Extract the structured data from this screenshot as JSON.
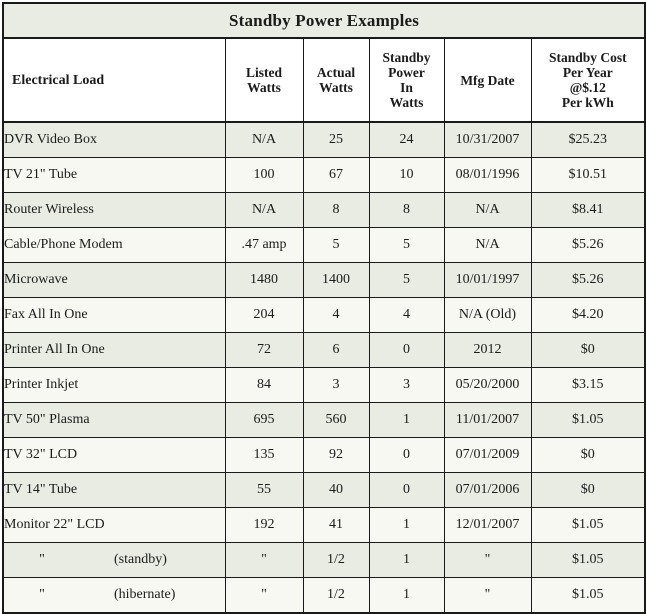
{
  "table": {
    "title": "Standby Power Examples",
    "columns": [
      {
        "key": "load",
        "label_lines": [
          "Electrical Load"
        ]
      },
      {
        "key": "listed",
        "label_lines": [
          "Listed",
          "Watts"
        ]
      },
      {
        "key": "actual",
        "label_lines": [
          "Actual",
          "Watts"
        ]
      },
      {
        "key": "standby",
        "label_lines": [
          "Standby",
          "Power",
          "In",
          "Watts"
        ]
      },
      {
        "key": "mfg",
        "label_lines": [
          "Mfg Date"
        ]
      },
      {
        "key": "cost",
        "label_lines": [
          "Standby Cost",
          "Per Year",
          "@$.12",
          "Per kWh"
        ]
      }
    ],
    "rows": [
      {
        "load": "DVR Video Box",
        "listed": "N/A",
        "actual": "25",
        "standby": "24",
        "mfg": "10/31/2007",
        "cost": "$25.23"
      },
      {
        "load": "TV 21\" Tube",
        "listed": "100",
        "actual": "67",
        "standby": "10",
        "mfg": "08/01/1996",
        "cost": "$10.51"
      },
      {
        "load": "Router Wireless",
        "listed": "N/A",
        "actual": "8",
        "standby": "8",
        "mfg": "N/A",
        "cost": "$8.41"
      },
      {
        "load": "Cable/Phone Modem",
        "listed": ".47 amp",
        "actual": "5",
        "standby": "5",
        "mfg": "N/A",
        "cost": "$5.26"
      },
      {
        "load": "Microwave",
        "listed": "1480",
        "actual": "1400",
        "standby": "5",
        "mfg": "10/01/1997",
        "cost": "$5.26"
      },
      {
        "load": "Fax All In One",
        "listed": "204",
        "actual": "4",
        "standby": "4",
        "mfg": "N/A (Old)",
        "cost": "$4.20"
      },
      {
        "load": "Printer All In One",
        "listed": "72",
        "actual": "6",
        "standby": "0",
        "mfg": "2012",
        "cost": "$0"
      },
      {
        "load": "Printer Inkjet",
        "listed": "84",
        "actual": "3",
        "standby": "3",
        "mfg": "05/20/2000",
        "cost": "$3.15"
      },
      {
        "load": "TV 50\" Plasma",
        "listed": "695",
        "actual": "560",
        "standby": "1",
        "mfg": "11/01/2007",
        "cost": "$1.05"
      },
      {
        "load": "TV 32\" LCD",
        "listed": "135",
        "actual": "92",
        "standby": "0",
        "mfg": "07/01/2009",
        "cost": "$0"
      },
      {
        "load": "TV 14\" Tube",
        "listed": "55",
        "actual": "40",
        "standby": "0",
        "mfg": "07/01/2006",
        "cost": "$0"
      },
      {
        "load": "Monitor 22\" LCD",
        "listed": "192",
        "actual": "41",
        "standby": "1",
        "mfg": "12/01/2007",
        "cost": "$1.05"
      },
      {
        "load_ditto": "\"",
        "load_note": "(standby)",
        "listed": "\"",
        "actual": "1/2",
        "standby": "1",
        "mfg": "\"",
        "cost": "$1.05"
      },
      {
        "load_ditto": "\"",
        "load_note": "(hibernate)",
        "listed": "\"",
        "actual": "1/2",
        "standby": "1",
        "mfg": "\"",
        "cost": "$1.05"
      }
    ]
  },
  "style": {
    "tint_row_bg": "#e9ece3",
    "plain_row_bg": "#f6f8f1",
    "header_bg": "#ffffff",
    "title_bg": "#e9ece3",
    "border_color": "#1a1a1a",
    "text_color": "#1b1b1b"
  }
}
